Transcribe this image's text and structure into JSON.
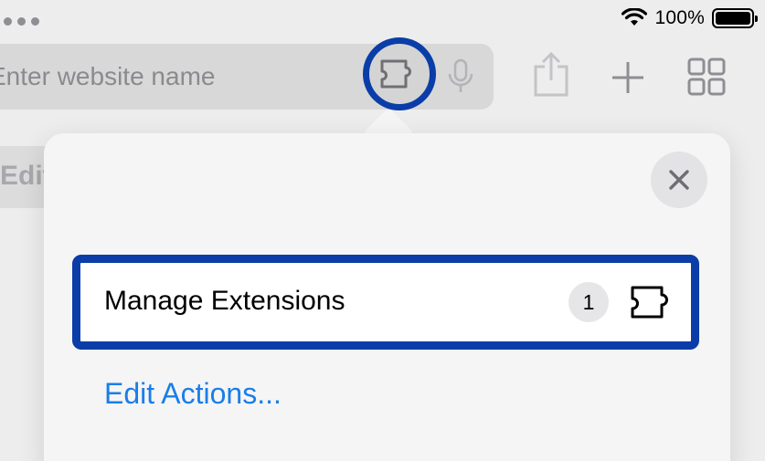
{
  "status_bar": {
    "battery_percent": "100%",
    "icons": [
      "more-dots-icon",
      "wifi-icon",
      "battery-icon"
    ]
  },
  "address_bar": {
    "placeholder": "Enter website name",
    "icons": [
      "extensions-puzzle-icon",
      "microphone-icon"
    ]
  },
  "toolbar": {
    "icons": [
      "share-icon",
      "add-tab-icon",
      "tab-overview-icon"
    ]
  },
  "background": {
    "tab_label": "Edit"
  },
  "popover": {
    "close_icon": "close-icon",
    "manage_extensions_label": "Manage Extensions",
    "extension_count": "1",
    "edit_actions_label": "Edit Actions..."
  },
  "colors": {
    "highlight": "#0a3da8",
    "link": "#1a7ee8"
  }
}
